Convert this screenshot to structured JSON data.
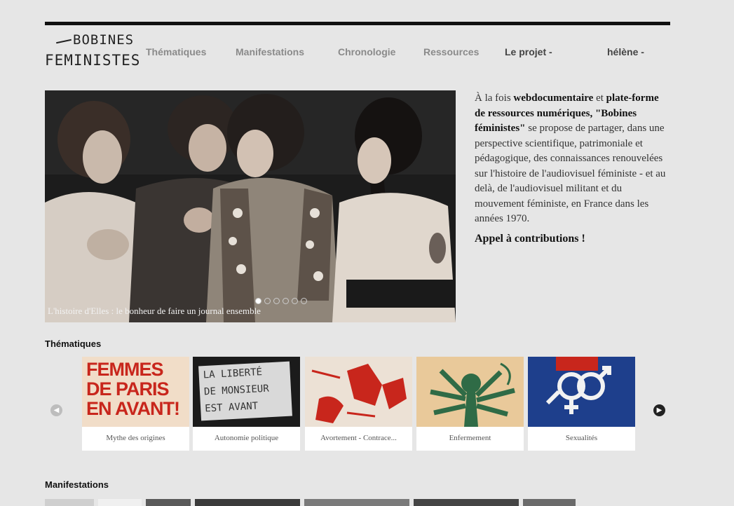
{
  "logo": {
    "line1": "BOBINES",
    "line2": "FEMINISTES"
  },
  "nav": [
    {
      "label": "Thématiques"
    },
    {
      "label": "Manifestations"
    },
    {
      "label": "Chronologie"
    },
    {
      "label": "Ressources"
    },
    {
      "label": "Le projet -"
    },
    {
      "label": "hélène -"
    }
  ],
  "hero": {
    "caption": "L'histoire d'Elles : le bonheur de faire un journal ensemble"
  },
  "intro": {
    "p1": "À la fois",
    "b1": "webdocumentaire",
    "p2": "et",
    "b2": "plate-forme de ressources numériques, \"Bobines féministes\"",
    "p3": "se propose de partager, dans une perspective scientifique, patrimoniale et pédagogique, des connaissances renouvelées sur l'histoire de l'audiovisuel féministe - et au delà, de l'audiovisuel militant et du mouvement féministe, en France dans les années 1970.",
    "appel": "Appel à contributions !"
  },
  "sections": {
    "thematiques": "Thématiques",
    "manifestations": "Manifestations"
  },
  "cards": [
    {
      "label": "Mythe des origines",
      "poster_text": [
        "FEMMES",
        "DE PARIS",
        "EN AVANT!"
      ]
    },
    {
      "label": "Autonomie politique",
      "poster_text": [
        "LA LIBERTÉ",
        "DE MONSIEUR",
        "EST AVANT"
      ]
    },
    {
      "label": "Avortement - Contrace...",
      "poster_text": []
    },
    {
      "label": "Enfermement",
      "poster_text": []
    },
    {
      "label": "Sexualités",
      "poster_text": []
    }
  ],
  "colors": {
    "accent_red": "#c8261c",
    "navy": "#1e3f8c",
    "green": "#2f6b46",
    "tan": "#e9c99a"
  }
}
